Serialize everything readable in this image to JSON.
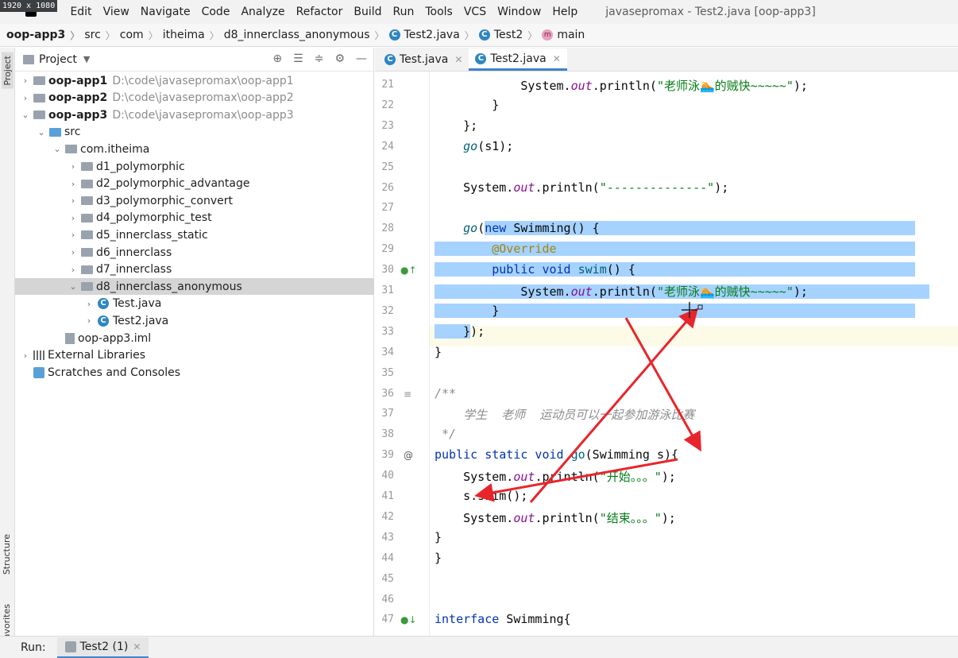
{
  "screen_badge": "1920 x 1080",
  "menu": {
    "items": [
      "File",
      "Edit",
      "View",
      "Navigate",
      "Code",
      "Analyze",
      "Refactor",
      "Build",
      "Run",
      "Tools",
      "VCS",
      "Window",
      "Help"
    ],
    "window_title": "javasepromax - Test2.java [oop-app3]"
  },
  "breadcrumb": [
    "oop-app3",
    "src",
    "com",
    "itheima",
    "d8_innerclass_anonymous",
    "Test2.java",
    "Test2",
    "main"
  ],
  "side_tabs": {
    "project": "Project",
    "structure": "Structure",
    "favorites": "Favorites"
  },
  "project_panel": {
    "title": "Project",
    "tree": [
      {
        "label": "oop-app1",
        "path": "D:\\code\\javasepromax\\oop-app1",
        "depth": 0,
        "arrow": "›",
        "icon": "module-folder"
      },
      {
        "label": "oop-app2",
        "path": "D:\\code\\javasepromax\\oop-app2",
        "depth": 0,
        "arrow": "›",
        "icon": "module-folder"
      },
      {
        "label": "oop-app3",
        "path": "D:\\code\\javasepromax\\oop-app3",
        "depth": 0,
        "arrow": "⌄",
        "icon": "module-folder"
      },
      {
        "label": "src",
        "path": "",
        "depth": 1,
        "arrow": "⌄",
        "icon": "src-folder"
      },
      {
        "label": "com.itheima",
        "path": "",
        "depth": 2,
        "arrow": "⌄",
        "icon": "package-folder"
      },
      {
        "label": "d1_polymorphic",
        "path": "",
        "depth": 3,
        "arrow": "›",
        "icon": "package-folder"
      },
      {
        "label": "d2_polymorphic_advantage",
        "path": "",
        "depth": 3,
        "arrow": "›",
        "icon": "package-folder"
      },
      {
        "label": "d3_polymorphic_convert",
        "path": "",
        "depth": 3,
        "arrow": "›",
        "icon": "package-folder"
      },
      {
        "label": "d4_polymorphic_test",
        "path": "",
        "depth": 3,
        "arrow": "›",
        "icon": "package-folder"
      },
      {
        "label": "d5_innerclass_static",
        "path": "",
        "depth": 3,
        "arrow": "›",
        "icon": "package-folder"
      },
      {
        "label": "d6_innerclass",
        "path": "",
        "depth": 3,
        "arrow": "›",
        "icon": "package-folder"
      },
      {
        "label": "d7_innerclass",
        "path": "",
        "depth": 3,
        "arrow": "›",
        "icon": "package-folder"
      },
      {
        "label": "d8_innerclass_anonymous",
        "path": "",
        "depth": 3,
        "arrow": "⌄",
        "icon": "package-folder",
        "selected": true
      },
      {
        "label": "Test.java",
        "path": "",
        "depth": 4,
        "arrow": "›",
        "icon": "class-file"
      },
      {
        "label": "Test2.java",
        "path": "",
        "depth": 4,
        "arrow": "›",
        "icon": "class-file"
      },
      {
        "label": "oop-app3.iml",
        "path": "",
        "depth": 2,
        "arrow": "",
        "icon": "iml-file"
      },
      {
        "label": "External Libraries",
        "path": "",
        "depth": 0,
        "arrow": "›",
        "icon": "libraries"
      },
      {
        "label": "Scratches and Consoles",
        "path": "",
        "depth": 0,
        "arrow": "",
        "icon": "scratches"
      }
    ]
  },
  "editor": {
    "tabs": [
      {
        "label": "Test.java",
        "active": false
      },
      {
        "label": "Test2.java",
        "active": true
      }
    ],
    "lines": [
      {
        "n": "21",
        "html": "            <span class=\"kw\"></span>System.<span class=\"it\">out</span>.println(<span class=\"str\">\"老师泳🏊的贼快~~~~~\"</span>);"
      },
      {
        "n": "22",
        "html": "        }"
      },
      {
        "n": "23",
        "html": "    };"
      },
      {
        "n": "24",
        "html": "    <span class=\"fn\">go</span>(s1);"
      },
      {
        "n": "25",
        "html": ""
      },
      {
        "n": "26",
        "html": "    System.<span class=\"it\">out</span>.println(<span class=\"str\">\"--------------\"</span>);"
      },
      {
        "n": "27",
        "html": ""
      },
      {
        "n": "28",
        "html": "    <span class=\"fn\">go</span>(<span class=\"sel\"><span class=\"kw\">new</span> Swimming() {                                            </span>"
      },
      {
        "n": "29",
        "html": "<span class=\"sel\">        <span class=\"ann\">@Override</span>                                                  </span>"
      },
      {
        "n": "30",
        "html": "<span class=\"sel\">        <span class=\"kw\">public void</span> <span style=\"color:#00627a\">swim</span>() {                                       </span>"
      },
      {
        "n": "31",
        "html": "<span class=\"sel\">            System.<span class=\"it\">out</span>.println(<span class=\"str\">\"老师泳🏊的贼快~~~~~\"</span>);                 </span>"
      },
      {
        "n": "32",
        "html": "<span class=\"sel\">        }                                                          </span>"
      },
      {
        "n": "33",
        "html": "<span class=\"sel\">    }</span>);"
      },
      {
        "n": "34",
        "html": "}"
      },
      {
        "n": "35",
        "html": ""
      },
      {
        "n": "36",
        "html": "<span class=\"cmt\">/**</span>"
      },
      {
        "n": "37",
        "html": "<span class=\"cmt\">    学生  老师  运动员可以一起参加游泳比赛</span>"
      },
      {
        "n": "38",
        "html": "<span class=\"cmt\"> */</span>"
      },
      {
        "n": "39",
        "html": "<span class=\"kw\">public static void</span> <span style=\"color:#00627a\">go</span>(Swimming s){"
      },
      {
        "n": "40",
        "html": "    System.<span class=\"it\">out</span>.println(<span class=\"str\">\"开始。。。\"</span>);"
      },
      {
        "n": "41",
        "html": "    s.swim();"
      },
      {
        "n": "42",
        "html": "    System.<span class=\"it\">out</span>.println(<span class=\"str\">\"结束。。。\"</span>);"
      },
      {
        "n": "43",
        "html": "}"
      },
      {
        "n": "44",
        "html": "}"
      },
      {
        "n": "45",
        "html": ""
      },
      {
        "n": "46",
        "html": ""
      },
      {
        "n": "47",
        "html": "<span class=\"kw\">interface</span> Swimming{"
      }
    ]
  },
  "run_bar": {
    "label": "Run:",
    "tab": "Test2 (1)"
  },
  "colors": {
    "selection": "#a6d2ff",
    "annotation_arrow": "#e8252b",
    "accent": "#4083c9"
  }
}
